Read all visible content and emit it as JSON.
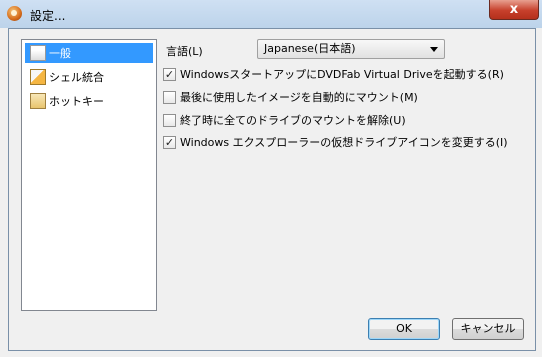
{
  "window": {
    "title": "設定...",
    "close_label": "x"
  },
  "sidebar": {
    "items": [
      {
        "label": "一般",
        "icon": "general-settings-icon",
        "selected": true
      },
      {
        "label": "シェル統合",
        "icon": "shell-integration-icon",
        "selected": false
      },
      {
        "label": "ホットキー",
        "icon": "hotkey-icon",
        "selected": false
      }
    ]
  },
  "general": {
    "language_label": "言語(L)",
    "language_value": "Japanese(日本語)",
    "options": [
      {
        "label": "WindowsスタートアップにDVDFab Virtual Driveを起動する(R)",
        "checked": true,
        "check_mark": "✓"
      },
      {
        "label": "最後に使用したイメージを自動的にマウント(M)",
        "checked": false,
        "check_mark": ""
      },
      {
        "label": "終了時に全てのドライブのマウントを解除(U)",
        "checked": false,
        "check_mark": ""
      },
      {
        "label": "Windows エクスプローラーの仮想ドライブアイコンを変更する(I)",
        "checked": true,
        "check_mark": "✓"
      }
    ]
  },
  "footer": {
    "ok_label": "OK",
    "cancel_label": "キャンセル"
  },
  "colors": {
    "selection": "#3399ff",
    "titlebar": "#bcd3ea",
    "close_button": "#c7402c"
  }
}
